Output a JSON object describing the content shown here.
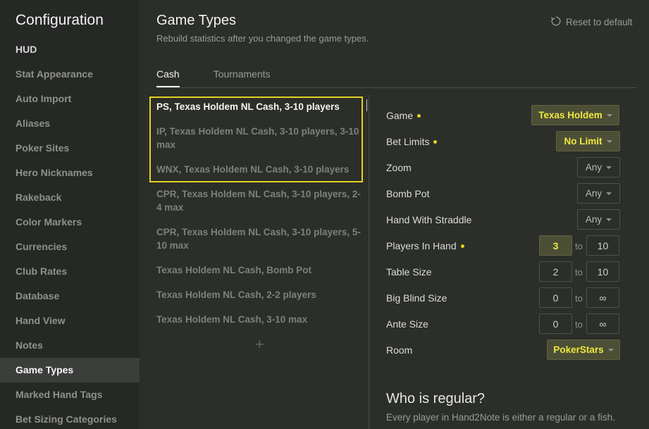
{
  "sidebar": {
    "title": "Configuration",
    "items": [
      {
        "label": "HUD"
      },
      {
        "label": "Stat Appearance"
      },
      {
        "label": "Auto Import"
      },
      {
        "label": "Aliases"
      },
      {
        "label": "Poker Sites"
      },
      {
        "label": "Hero Nicknames"
      },
      {
        "label": "Rakeback"
      },
      {
        "label": "Color Markers"
      },
      {
        "label": "Currencies"
      },
      {
        "label": "Club Rates"
      },
      {
        "label": "Database"
      },
      {
        "label": "Hand View"
      },
      {
        "label": "Notes"
      },
      {
        "label": "Game Types"
      },
      {
        "label": "Marked Hand Tags"
      },
      {
        "label": "Bet Sizing Categories"
      }
    ],
    "active_item": "Game Types"
  },
  "header": {
    "title": "Game Types",
    "subtitle": "Rebuild statistics after you changed the game types.",
    "reset_label": "Reset to default"
  },
  "tabs": [
    {
      "label": "Cash",
      "active": true
    },
    {
      "label": "Tournaments",
      "active": false
    }
  ],
  "game_types": [
    {
      "label": "PS, Texas Holdem NL Cash, 3-10 players",
      "selected": true
    },
    {
      "label": "IP, Texas Holdem NL Cash, 3-10 players, 3-10 max",
      "selected": false
    },
    {
      "label": "WNX, Texas Holdem NL Cash, 3-10 players",
      "selected": false
    },
    {
      "label": "CPR, Texas Holdem NL Cash, 3-10 players, 2-4 max",
      "selected": false
    },
    {
      "label": "CPR, Texas Holdem NL Cash, 3-10 players, 5-10 max",
      "selected": false
    },
    {
      "label": "Texas Holdem NL Cash, Bomb Pot",
      "selected": false
    },
    {
      "label": "Texas Holdem NL Cash, 2-2 players",
      "selected": false
    },
    {
      "label": "Texas Holdem NL Cash, 3-10 max",
      "selected": false
    }
  ],
  "add_symbol": "+",
  "filters": {
    "game": {
      "label": "Game",
      "value": "Texas Holdem"
    },
    "bet_limits": {
      "label": "Bet Limits",
      "value": "No Limit"
    },
    "zoom": {
      "label": "Zoom",
      "value": "Any"
    },
    "bomb_pot": {
      "label": "Bomb Pot",
      "value": "Any"
    },
    "straddle": {
      "label": "Hand With Straddle",
      "value": "Any"
    },
    "players_in_hand": {
      "label": "Players In Hand",
      "from": "3",
      "to": "10"
    },
    "table_size": {
      "label": "Table Size",
      "from": "2",
      "to": "10"
    },
    "big_blind_size": {
      "label": "Big Blind Size",
      "from": "0",
      "to": "∞"
    },
    "ante_size": {
      "label": "Ante Size",
      "from": "0",
      "to": "∞"
    },
    "room": {
      "label": "Room",
      "value": "PokerStars"
    },
    "to_label": "to"
  },
  "regular": {
    "title": "Who is regular?",
    "subtitle": "Every player in Hand2Note is either a regular or a fish."
  },
  "colors": {
    "accent_yellow": "#e3d31f",
    "highlight_bg": "#4c4f36",
    "panel_bg": "#2b2e29",
    "sidebar_bg": "#262826"
  }
}
